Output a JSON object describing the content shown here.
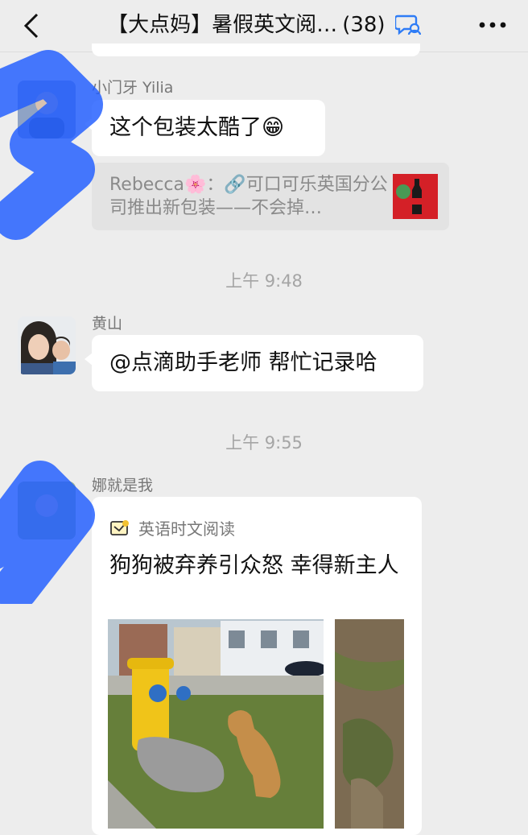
{
  "header": {
    "title": "【大点妈】暑假英文阅…",
    "member_count": "(38)",
    "back_icon": "chevron-left-icon",
    "group_icon": "group-chat-icon",
    "more_icon": "ellipsis-icon"
  },
  "messages": [
    {
      "sender": "小门牙 Yilia",
      "text": "这个包装太酷了😁",
      "quote": "Rebecca🌸：🔗可口可乐英国分公司推出新包装——不会掉…"
    },
    {
      "sender": "黄山",
      "text": "@点滴助手老师 帮忙记录哈"
    },
    {
      "sender": "娜就是我",
      "card": {
        "source": "英语时文阅读",
        "title": "狗狗被弃养引众怒 幸得新主人"
      }
    }
  ],
  "timestamps": [
    "上午 9:48",
    "上午 9:55"
  ],
  "colors": {
    "background": "#ededed",
    "bubble": "#ffffff",
    "scribble": "#1f5cff"
  }
}
